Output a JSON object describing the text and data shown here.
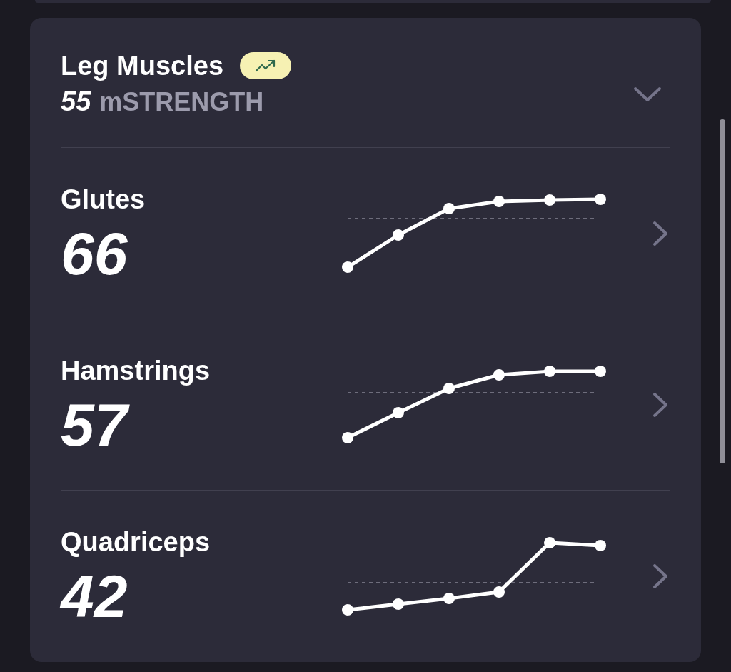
{
  "section": {
    "title": "Leg Muscles",
    "score": "55",
    "unit": "mSTRENGTH"
  },
  "muscles": [
    {
      "name": "Glutes",
      "score": "66"
    },
    {
      "name": "Hamstrings",
      "score": "57"
    },
    {
      "name": "Quadriceps",
      "score": "42"
    }
  ]
}
